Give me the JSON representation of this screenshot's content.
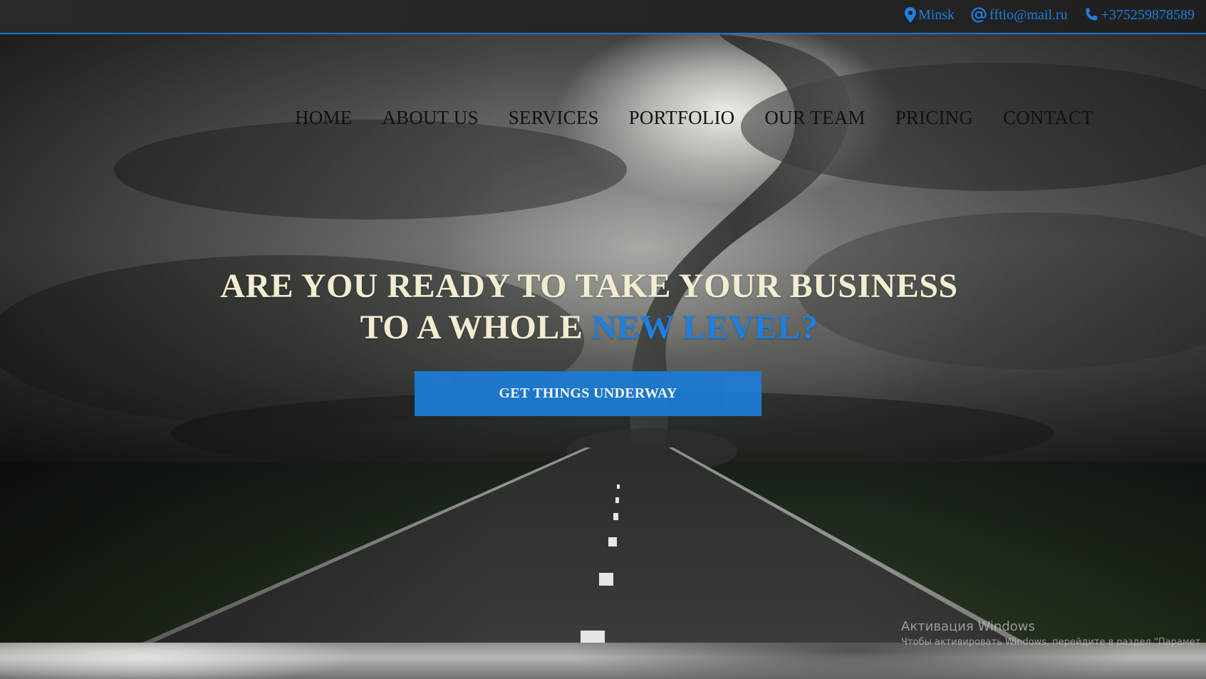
{
  "contacts": {
    "city": "Minsk",
    "email": "fftio@mail.ru",
    "phone": "+375259878589"
  },
  "nav": {
    "items": [
      {
        "label": "HOME"
      },
      {
        "label": "ABOUT US"
      },
      {
        "label": "SERVICES"
      },
      {
        "label": "PORTFOLIO"
      },
      {
        "label": "OUR TEAM"
      },
      {
        "label": "PRICING"
      },
      {
        "label": "CONTACT"
      }
    ]
  },
  "hero": {
    "line1": "ARE YOU READY TO TAKE YOUR BUSINESS",
    "line2_prefix": "TO A WHOLE ",
    "line2_accent": "NEW LEVEL?",
    "cta_label": "GET THINGS UNDERWAY"
  },
  "watermark": {
    "title": "Активация Windows",
    "subtitle": "Чтобы активировать Windows, перейдите в раздел \"Парамет"
  },
  "colors": {
    "accent": "#1e7fe0",
    "button": "#1d7bd2",
    "headline": "#f4ecd2",
    "nav_text": "#111111"
  },
  "icons": [
    "map-marker-icon",
    "at-sign-icon",
    "phone-icon"
  ]
}
